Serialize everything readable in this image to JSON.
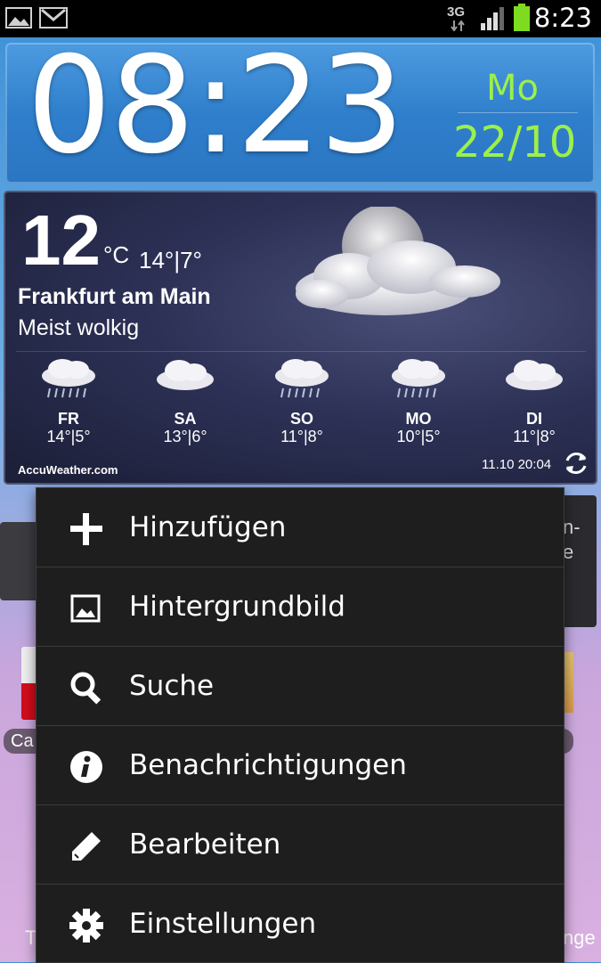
{
  "status_bar": {
    "network": "3G",
    "time": "8:23",
    "battery_color": "#7ddc1f"
  },
  "clock_widget": {
    "time": "08:23",
    "day": "Mo",
    "date": "22/10"
  },
  "weather_widget": {
    "temperature": "12",
    "unit": "°C",
    "range": "14°|7°",
    "city": "Frankfurt am Main",
    "condition": "Meist wolkig",
    "forecast": [
      {
        "day": "FR",
        "range": "14°|5°",
        "icon": "rain-cloud-icon"
      },
      {
        "day": "SA",
        "range": "13°|6°",
        "icon": "cloud-icon"
      },
      {
        "day": "SO",
        "range": "11°|8°",
        "icon": "rain-cloud-icon"
      },
      {
        "day": "MO",
        "range": "10°|5°",
        "icon": "rain-cloud-icon"
      },
      {
        "day": "DI",
        "range": "11°|8°",
        "icon": "cloud-icon"
      }
    ],
    "brand": "AccuWeather.com",
    "updated": "11.10 20:04"
  },
  "background": {
    "left_label": "Ca",
    "right_widget_text": "n-\ne",
    "bottom_left_text": "T",
    "bottom_right_text": "nge"
  },
  "menu": {
    "items": [
      {
        "label": "Hinzufügen",
        "icon": "plus-icon"
      },
      {
        "label": "Hintergrundbild",
        "icon": "image-icon"
      },
      {
        "label": "Suche",
        "icon": "search-icon"
      },
      {
        "label": "Benachrichtigungen",
        "icon": "info-icon"
      },
      {
        "label": "Bearbeiten",
        "icon": "pencil-icon"
      },
      {
        "label": "Einstellungen",
        "icon": "gear-icon"
      }
    ]
  },
  "colors": {
    "accent_green": "#9cf04a",
    "clock_blue": "#2f7fcc",
    "menu_bg": "#1e1e1e"
  }
}
